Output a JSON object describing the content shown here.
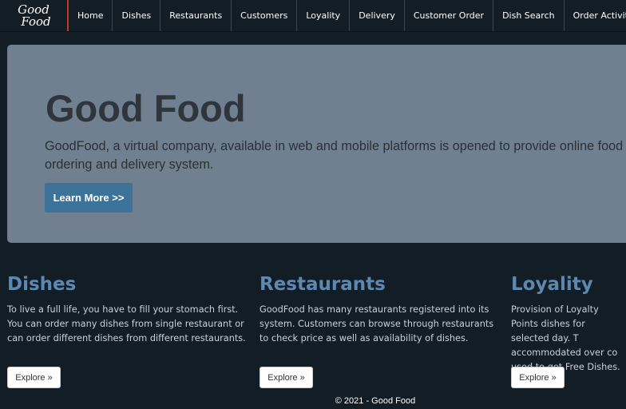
{
  "brand": {
    "line1": "Good",
    "line2": "Food"
  },
  "nav": {
    "items": [
      {
        "label": "Home"
      },
      {
        "label": "Dishes"
      },
      {
        "label": "Restaurants"
      },
      {
        "label": "Customers"
      },
      {
        "label": "Loyality"
      },
      {
        "label": "Delivery"
      },
      {
        "label": "Customer Order"
      },
      {
        "label": "Dish Search"
      },
      {
        "label": "Order Activity"
      }
    ]
  },
  "hero": {
    "title": "Good Food",
    "text": "GoodFood, a virtual company, available in web and mobile platforms is opened to provide online food ordering and delivery system.",
    "button_label": "Learn More >>"
  },
  "sections": [
    {
      "title": "Dishes",
      "text": "To live a full life, you have to fill your stomach first. You can order many dishes from single restaurant or can order different dishes from different restaurants.",
      "button_label": "Explore »"
    },
    {
      "title": "Restaurants",
      "text": "GoodFood has many restaurants registered into its system. Customers can browse through restaurants to check price as well as availability of dishes.",
      "button_label": "Explore »"
    },
    {
      "title": "Loyality",
      "text": "Provision of Loyalty Points dishes for selected day. T accommodated over co used to get Free Dishes.",
      "button_label": "Explore »"
    }
  ],
  "footer": {
    "text": "© 2021 - Good Food"
  },
  "colors": {
    "background": "#121d26",
    "hero_background": "#708090",
    "accent": "#3d7399",
    "section_title": "#5d88b0",
    "brand_divider": "#c0392b"
  }
}
